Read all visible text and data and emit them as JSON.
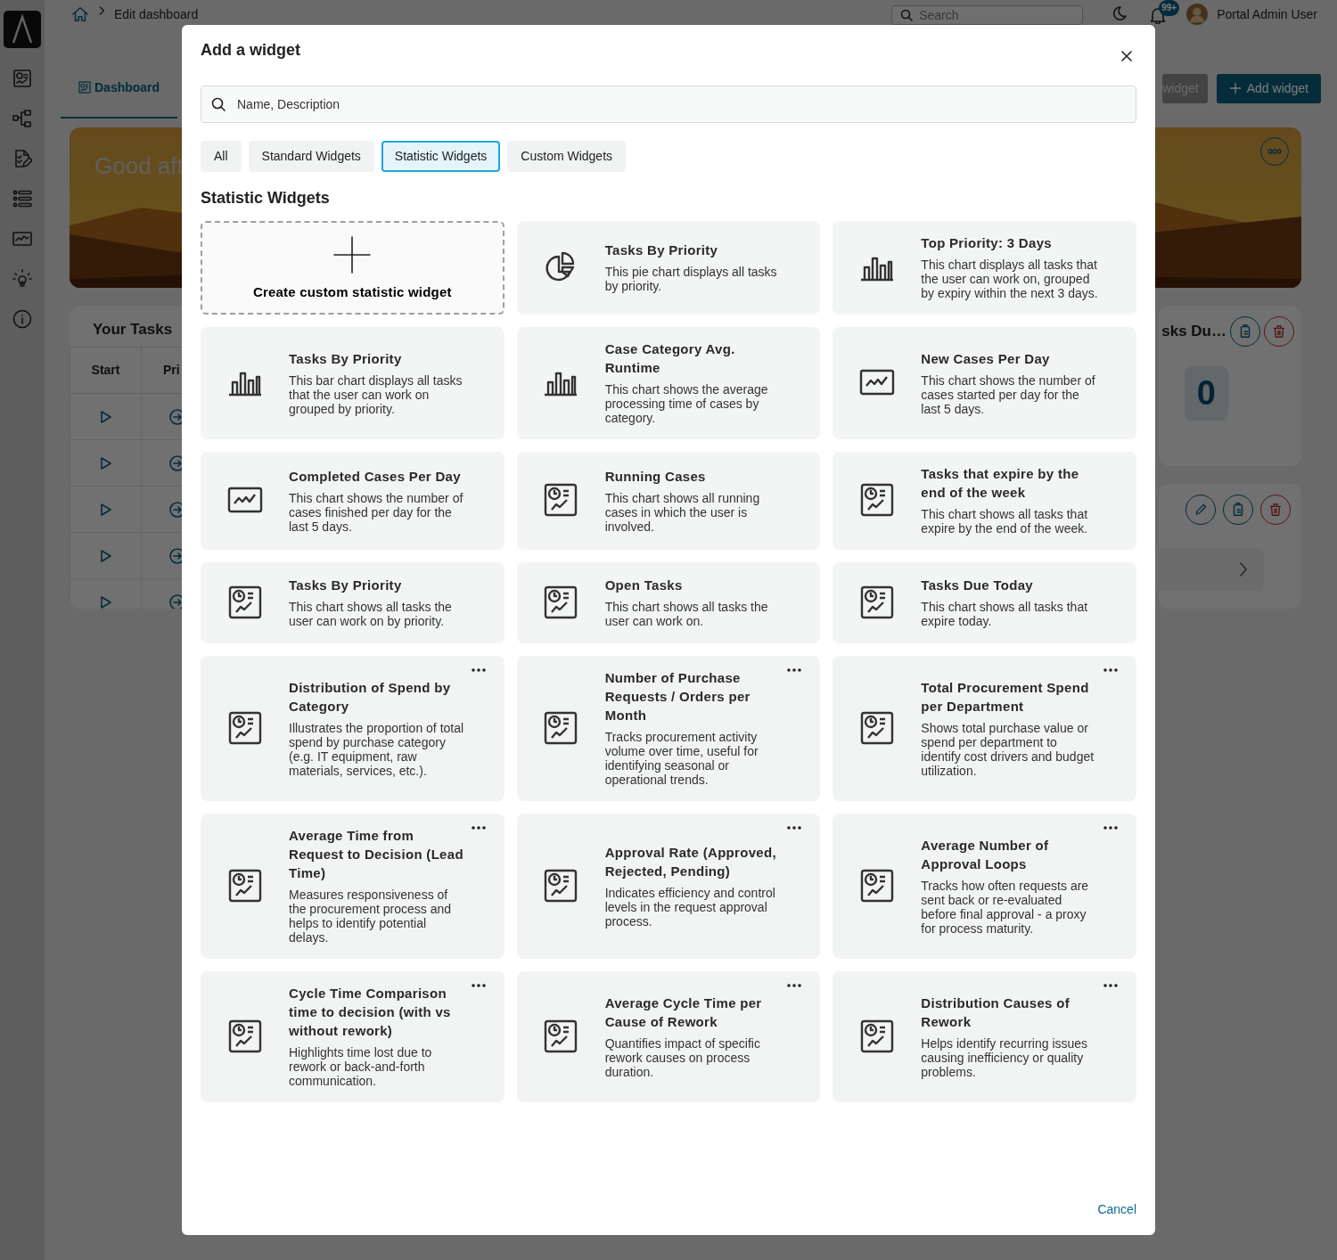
{
  "background": {
    "breadcrumb": "Edit dashboard",
    "search": {
      "placeholder": "Search"
    },
    "notification_count": "99+",
    "user_name": "Portal Admin User",
    "tabs": [
      {
        "label": "Dashboard",
        "selected": true
      }
    ],
    "buttons": [
      {
        "label": "widget",
        "kind": "secondary"
      },
      {
        "label": "Add widget",
        "kind": "primary"
      }
    ],
    "greeting": "Good aft",
    "tasks_card": {
      "title": "Your Tasks",
      "columns": [
        "Start",
        "Pri"
      ]
    },
    "count_card": {
      "title": "sks Du…",
      "value": "0"
    }
  },
  "dialog": {
    "title": "Add a widget",
    "search": {
      "placeholder": "Name, Description"
    },
    "filters": [
      {
        "label": "All",
        "selected": false
      },
      {
        "label": "Standard Widgets",
        "selected": false
      },
      {
        "label": "Statistic Widgets",
        "selected": true
      },
      {
        "label": "Custom Widgets",
        "selected": false
      }
    ],
    "section_title": "Statistic Widgets",
    "create_tile": {
      "label": "Create custom statistic widget"
    },
    "widgets": [
      {
        "title": "Tasks By Priority",
        "description": "This pie chart displays all tasks by priority.",
        "kind": "pie",
        "menu": false
      },
      {
        "title": "Top Priority: 3 Days",
        "description": "This chart displays all tasks that the user can work on, grouped by expiry within the next 3 days.",
        "kind": "bar",
        "menu": false
      },
      {
        "title": "Tasks By Priority",
        "description": "This bar chart displays all tasks that the user can work on grouped by priority.",
        "kind": "bar",
        "menu": false
      },
      {
        "title": "Case Category Avg. Runtime",
        "description": "This chart shows the average processing time of cases by category.",
        "kind": "bar",
        "menu": false
      },
      {
        "title": "New Cases Per Day",
        "description": "This chart shows the number of cases started per day for the last 5 days.",
        "kind": "line",
        "menu": false
      },
      {
        "title": "Completed Cases Per Day",
        "description": "This chart shows the number of cases finished per day for the last 5 days.",
        "kind": "line",
        "menu": false
      },
      {
        "title": "Running Cases",
        "description": "This chart shows all running cases in which the user is involved.",
        "kind": "report",
        "menu": false
      },
      {
        "title": "Tasks that expire by the end of the week",
        "description": "This chart shows all tasks that expire by the end of the week.",
        "kind": "report",
        "menu": false
      },
      {
        "title": "Tasks By Priority",
        "description": "This chart shows all tasks the user can work on by priority.",
        "kind": "report",
        "menu": false
      },
      {
        "title": "Open Tasks",
        "description": "This chart shows all tasks the user can work on.",
        "kind": "report",
        "menu": false
      },
      {
        "title": "Tasks Due Today",
        "description": "This chart shows all tasks that expire today.",
        "kind": "report",
        "menu": false
      },
      {
        "title": "Distribution of Spend by Category",
        "description": "Illustrates the proportion of total spend by purchase category (e.g. IT equipment, raw materials, services, etc.).",
        "kind": "report",
        "menu": true
      },
      {
        "title": "Number of Purchase Requests / Orders per Month",
        "description": "Tracks procurement activity volume over time, useful for identifying seasonal or operational trends.",
        "kind": "report",
        "menu": true
      },
      {
        "title": "Total Procurement Spend per Department",
        "description": "Shows total purchase value or spend per department to identify cost drivers and budget utilization.",
        "kind": "report",
        "menu": true
      },
      {
        "title": "Average Time from Request to Decision (Lead Time)",
        "description": "Measures responsiveness of the procurement process and helps to identify potential delays.",
        "kind": "report",
        "menu": true
      },
      {
        "title": "Approval Rate (Approved, Rejected, Pending)",
        "description": "Indicates efficiency and control levels in the request approval process.",
        "kind": "report",
        "menu": true
      },
      {
        "title": "Average Number of Approval Loops",
        "description": "Tracks how often requests are sent back or re-evaluated before final approval - a proxy for process maturity.",
        "kind": "report",
        "menu": true
      },
      {
        "title": "Cycle Time Comparison time to decision (with vs without rework)",
        "description": "Highlights time lost due to rework or back-and-forth communication.",
        "kind": "report",
        "menu": true
      },
      {
        "title": "Average Cycle Time per Cause of Rework",
        "description": "Quantifies impact of specific rework causes on process duration.",
        "kind": "report",
        "menu": true
      },
      {
        "title": "Distribution Causes of Rework",
        "description": "Helps identify recurring issues causing inefficiency or quality problems.",
        "kind": "report",
        "menu": true
      }
    ],
    "cancel": "Cancel"
  }
}
